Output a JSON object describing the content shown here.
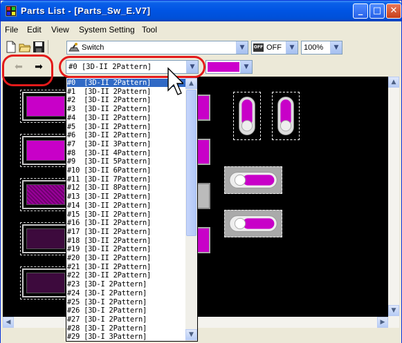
{
  "window": {
    "title": "Parts List - [Parts_Sw_E.V7]",
    "minimize": "_",
    "maximize": "□",
    "close": "✕"
  },
  "menu": [
    "File",
    "Edit",
    "View",
    "System Setting",
    "Tool"
  ],
  "toolbar": {
    "category_value": "Switch",
    "state_value": "OFF",
    "state_icon_text": "OFF",
    "zoom_value": "100%"
  },
  "toolbar2": {
    "pattern_value": "#0 [3D-II 2Pattern]"
  },
  "dropdown_items": [
    "#0  [3D-II 2Pattern]",
    "#1  [3D-II 2Pattern]",
    "#2  [3D-II 2Pattern]",
    "#3  [3D-II 2Pattern]",
    "#4  [3D-II 2Pattern]",
    "#5  [3D-II 2Pattern]",
    "#6  [3D-II 2Pattern]",
    "#7  [3D-II 3Pattern]",
    "#8  [3D-II 4Pattern]",
    "#9  [3D-II 5Pattern]",
    "#10 [3D-II 6Pattern]",
    "#11 [3D-II 7Pattern]",
    "#12 [3D-II 8Pattern]",
    "#13 [3D-II 2Pattern]",
    "#14 [3D-II 2Pattern]",
    "#15 [3D-II 2Pattern]",
    "#16 [3D-II 2Pattern]",
    "#17 [3D-II 2Pattern]",
    "#18 [3D-II 2Pattern]",
    "#19 [3D-II 2Pattern]",
    "#20 [3D-II 2Pattern]",
    "#21 [3D-II 2Pattern]",
    "#22 [3D-II 2Pattern]",
    "#23 [3D-I 2Pattern]",
    "#24 [3D-I 2Pattern]",
    "#25 [3D-I 2Pattern]",
    "#26 [3D-I 2Pattern]",
    "#27 [3D-I 2Pattern]",
    "#28 [3D-I 2Pattern]",
    "#29 [3D-I 3Pattern]"
  ],
  "selected_index": 0,
  "colors": {
    "accent_magenta": "#cc00cc",
    "highlight_red": "#e41a1a",
    "selection_blue": "#316ac5"
  }
}
